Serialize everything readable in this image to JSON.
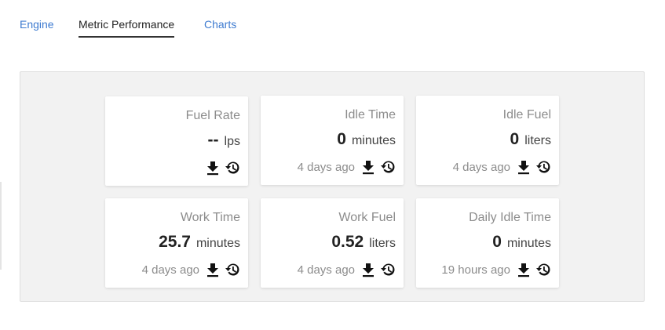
{
  "tabs": [
    {
      "label": "Engine",
      "active": false
    },
    {
      "label": "Metric Performance",
      "active": true
    },
    {
      "label": "Charts",
      "active": false
    }
  ],
  "colors": {
    "link": "#3e7bd0",
    "panel_bg": "#f2f2f2",
    "card_bg": "#ffffff",
    "muted_text": "#8c8c8c",
    "value_text": "#222222"
  },
  "cards": [
    {
      "title": "Fuel Rate",
      "value": "--",
      "unit": "lps",
      "updated": "",
      "icons": [
        "download-icon",
        "history-icon"
      ]
    },
    {
      "title": "Idle Time",
      "value": "0",
      "unit": "minutes",
      "updated": "4 days ago",
      "icons": [
        "download-icon",
        "history-icon"
      ]
    },
    {
      "title": "Idle Fuel",
      "value": "0",
      "unit": "liters",
      "updated": "4 days ago",
      "icons": [
        "download-icon",
        "history-icon"
      ]
    },
    {
      "title": "Work Time",
      "value": "25.7",
      "unit": "minutes",
      "updated": "4 days ago",
      "icons": [
        "download-icon",
        "history-icon"
      ]
    },
    {
      "title": "Work Fuel",
      "value": "0.52",
      "unit": "liters",
      "updated": "4 days ago",
      "icons": [
        "download-icon",
        "history-icon"
      ]
    },
    {
      "title": "Daily Idle Time",
      "value": "0",
      "unit": "minutes",
      "updated": "19 hours ago",
      "icons": [
        "download-icon",
        "history-icon"
      ]
    }
  ]
}
